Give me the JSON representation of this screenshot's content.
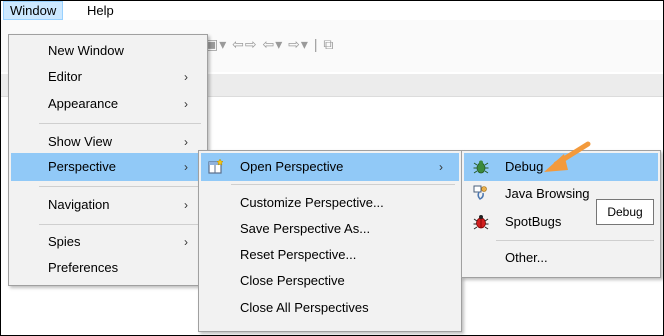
{
  "menubar": {
    "window_label": "Window",
    "help_label": "Help"
  },
  "window_menu": {
    "items": [
      {
        "label": "New Window"
      },
      {
        "label": "Editor"
      },
      {
        "label": "Appearance"
      },
      {
        "label": "Show View"
      },
      {
        "label": "Perspective"
      },
      {
        "label": "Navigation"
      },
      {
        "label": "Spies"
      },
      {
        "label": "Preferences"
      }
    ]
  },
  "perspective_menu": {
    "items": [
      {
        "label": "Open Perspective"
      },
      {
        "label": "Customize Perspective..."
      },
      {
        "label": "Save Perspective As..."
      },
      {
        "label": "Reset Perspective..."
      },
      {
        "label": "Close Perspective"
      },
      {
        "label": "Close All Perspectives"
      }
    ]
  },
  "open_perspective_menu": {
    "items": [
      {
        "label": "Debug"
      },
      {
        "label": "Java Browsing"
      },
      {
        "label": "SpotBugs"
      },
      {
        "label": "Other..."
      }
    ]
  },
  "tooltip": {
    "text": "Debug"
  },
  "arrow_glyph": "›",
  "accent": {
    "highlight": "#91c9f7",
    "menubar_active": "#cce8ff",
    "annotation_arrow": "#f39a3c"
  }
}
